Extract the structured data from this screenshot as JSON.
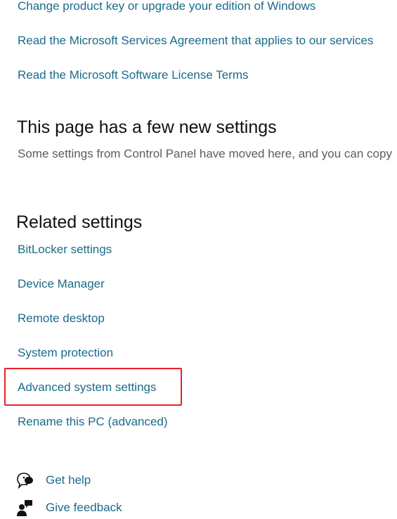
{
  "top_links": [
    "Change product key or upgrade your edition of Windows",
    "Read the Microsoft Services Agreement that applies to our services",
    "Read the Microsoft Software License Terms"
  ],
  "new_settings": {
    "title": "This page has a few new settings",
    "description": "Some settings from Control Panel have moved here, and you can copy"
  },
  "related_settings": {
    "title": "Related settings",
    "items": [
      "BitLocker settings",
      "Device Manager",
      "Remote desktop",
      "System protection",
      "Advanced system settings",
      "Rename this PC (advanced)"
    ]
  },
  "support": {
    "get_help": "Get help",
    "give_feedback": "Give feedback"
  },
  "colors": {
    "link": "#1a6b8a",
    "highlight": "#e8202a"
  }
}
